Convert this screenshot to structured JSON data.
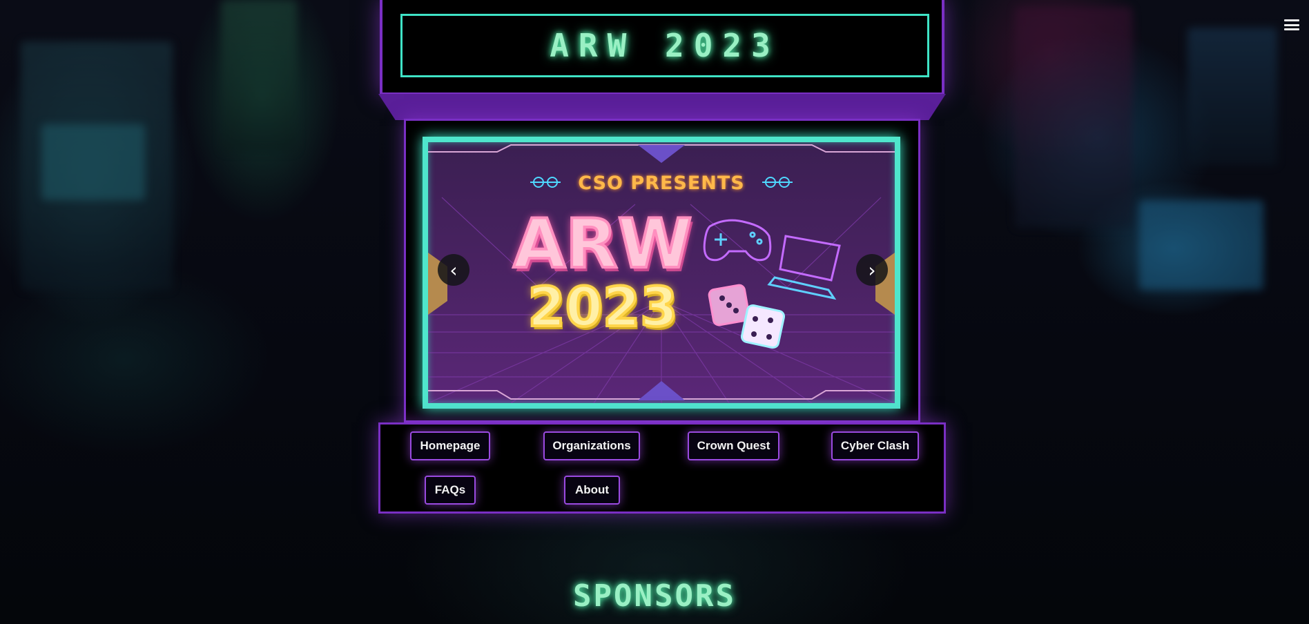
{
  "header": {
    "title": "ARW 2023",
    "menu_icon": "hamburger-menu-icon"
  },
  "slideshow": {
    "slide": {
      "presenter_text": "CSO PRESENTS",
      "headline": "ARW",
      "year": "2023"
    },
    "prev_label": "‹",
    "next_label": "›"
  },
  "nav": {
    "items": [
      {
        "label": "Homepage"
      },
      {
        "label": "Organizations"
      },
      {
        "label": "Crown Quest"
      },
      {
        "label": "Cyber Clash"
      },
      {
        "label": "FAQs"
      },
      {
        "label": "About"
      }
    ]
  },
  "sections": {
    "sponsors_heading": "SPONSORS"
  },
  "colors": {
    "cabinet_purple": "#7a2fc4",
    "neon_teal": "#3fe3c6",
    "neon_green_text": "#9af0c4",
    "slide_pink": "#ff8fbf",
    "slide_yellow": "#ffd54a",
    "slide_orange": "#ffb84a"
  }
}
